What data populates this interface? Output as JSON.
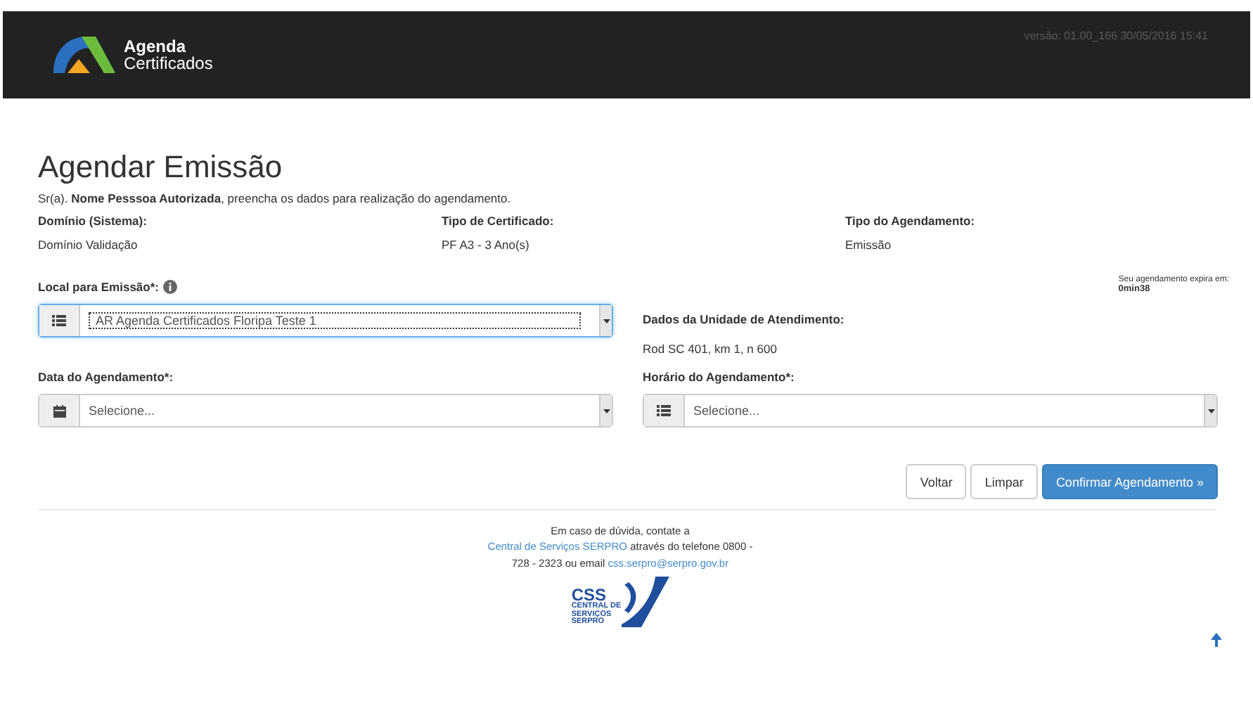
{
  "header": {
    "logo_line1": "Agenda",
    "logo_line2": "Certificados",
    "version": "versão: 01.00_166 30/05/2016 15:41"
  },
  "page": {
    "title": "Agendar Emissão",
    "intro": "Sr(a). **Nome Pesssoa Autorizada**, preencha os dados para realização do agendamento."
  },
  "summary": [
    {
      "label": "Domínio (Sistema):",
      "value": "Domínio Validação"
    },
    {
      "label": "Tipo de Certificado:",
      "value": "PF A3 - 3 Ano(s)"
    },
    {
      "label": "Tipo do Agendamento:",
      "value": "Emissão"
    }
  ],
  "local": {
    "label": "Local para Emissão*:",
    "value": "AR Agenda Certificados Floripa Teste 1",
    "focused": true
  },
  "expiry": {
    "label": "Seu agendamento expira em:",
    "time": "0min38"
  },
  "unit": {
    "label": "Dados da Unidade de Atendimento:",
    "address": "Rod SC 401, km 1, n 600"
  },
  "date": {
    "label": "Data do Agendamento*:",
    "placeholder": "Selecione..."
  },
  "time": {
    "label": "Horário do Agendamento*:",
    "placeholder": "Selecione..."
  },
  "buttons": [
    {
      "label": "Voltar",
      "kind": "default"
    },
    {
      "label": "Limpar",
      "kind": "default"
    },
    {
      "label": "Confirmar Agendamento »",
      "kind": "primary"
    }
  ],
  "footer": {
    "text_before": "Em caso de dúvida, contate a",
    "link1": "Central de Serviços SERPRO",
    "text_middle": "através do telefone 0800 - 728 - 2323 ou email",
    "link2": "css.serpro@serpro.gov.br",
    "logo_text": "CSS",
    "logo_sub": [
      "CENTRAL DE",
      "SERVIÇOS",
      "SERPRO"
    ]
  }
}
